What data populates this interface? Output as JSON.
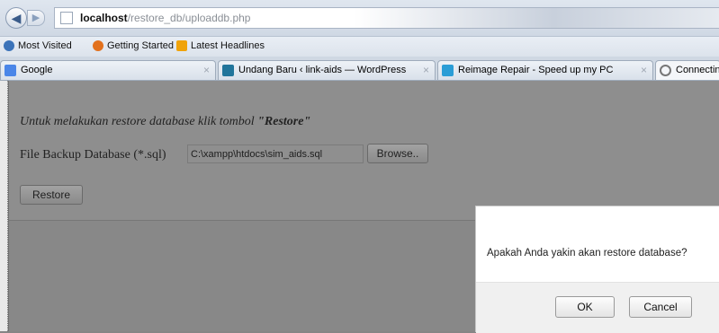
{
  "urlbar": {
    "host": "localhost",
    "path": "/restore_db/uploaddb.php"
  },
  "bookmarks": [
    {
      "label": "Most Visited",
      "icon": "most-visited-icon",
      "color": "#3b73b9"
    },
    {
      "label": "Getting Started",
      "icon": "firefox-icon",
      "color": "#e2711d"
    },
    {
      "label": "Latest Headlines",
      "icon": "rss-icon",
      "color": "#f0a30a"
    }
  ],
  "tabs": [
    {
      "label": "Google",
      "icon": "google-icon",
      "color": "#4a86e8"
    },
    {
      "label": "Undang Baru ‹ link-aids — WordPress",
      "icon": "wordpress-icon",
      "color": "#21759b"
    },
    {
      "label": "Reimage Repair - Speed up my PC",
      "icon": "reimage-icon",
      "color": "#2a9dd6"
    },
    {
      "label": "Connecting...",
      "icon": "loading-icon",
      "color": "#777777"
    }
  ],
  "page": {
    "instruction_prefix": "Untuk melakukan restore database klik tombol ",
    "instruction_strong": "\"Restore\"",
    "file_label": "File Backup Database (*.sql)",
    "file_value": "C:\\xampp\\htdocs\\sim_aids.sql",
    "browse_label": "Browse..",
    "restore_label": "Restore"
  },
  "dialog": {
    "message": "Apakah Anda yakin akan restore database?",
    "ok_label": "OK",
    "cancel_label": "Cancel"
  }
}
